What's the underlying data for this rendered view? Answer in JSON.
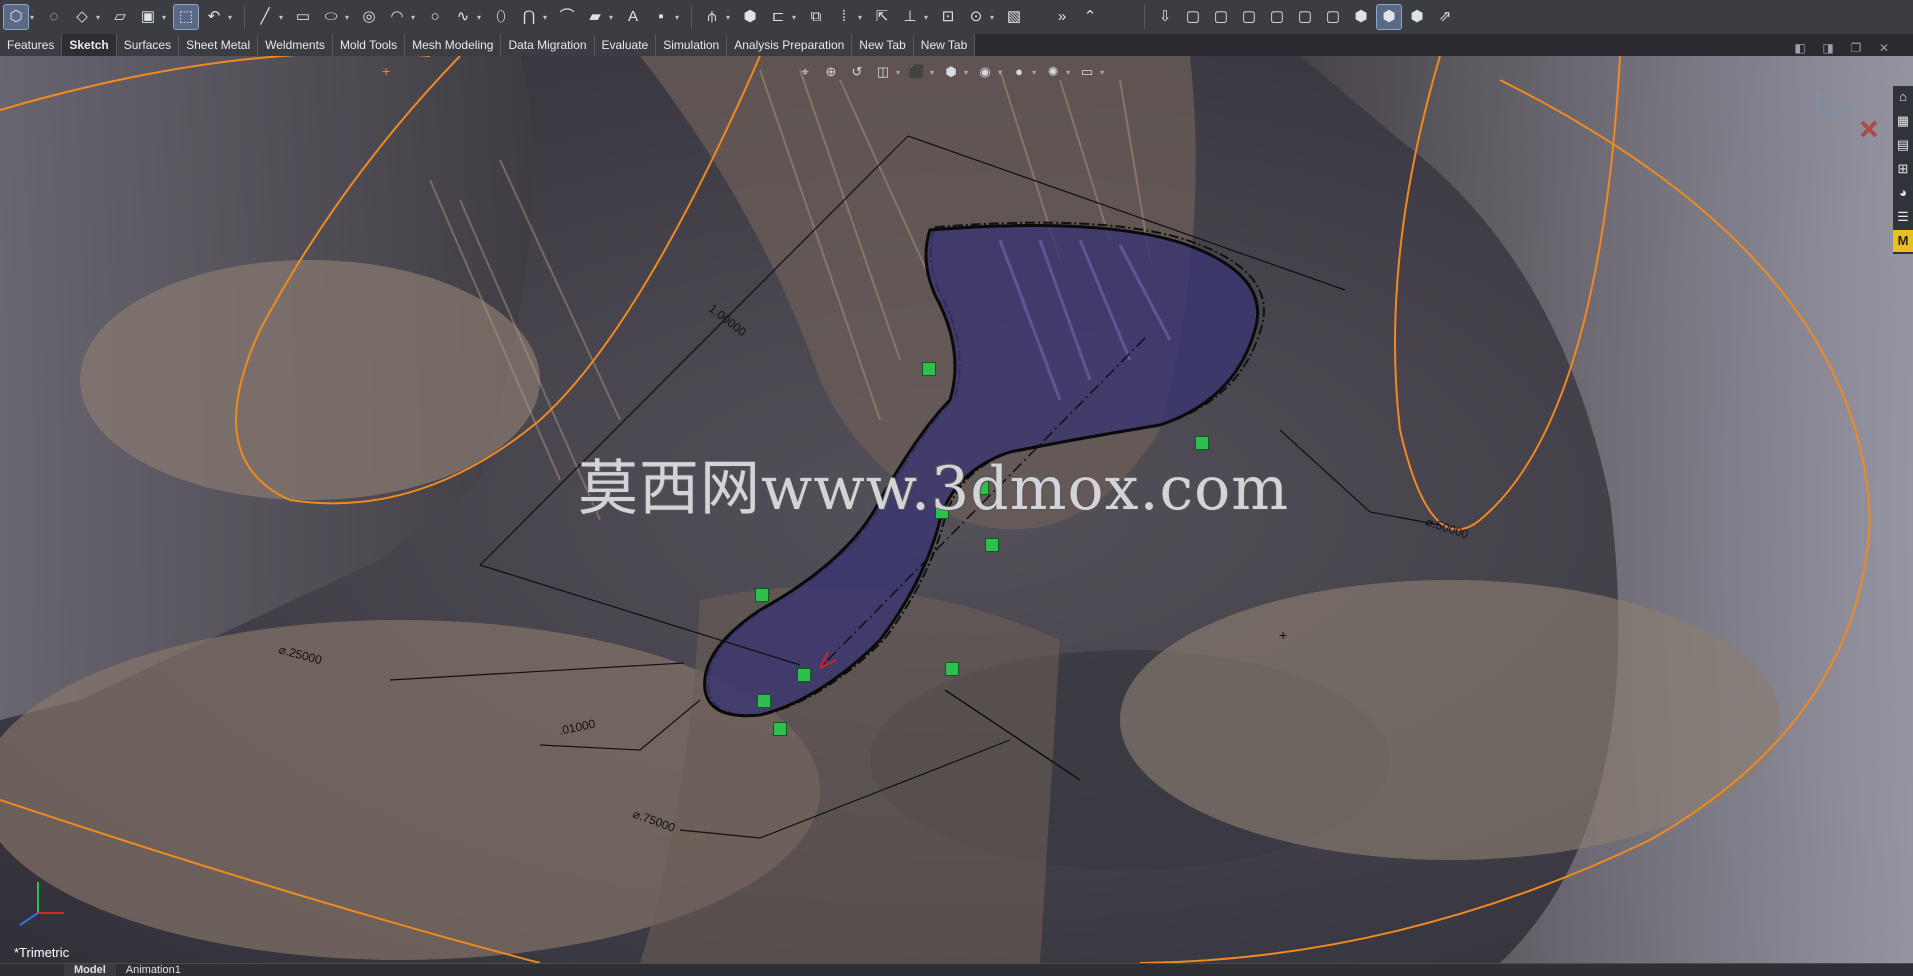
{
  "tabs": [
    {
      "label": "Features",
      "active": false
    },
    {
      "label": "Sketch",
      "active": true
    },
    {
      "label": "Surfaces",
      "active": false
    },
    {
      "label": "Sheet Metal",
      "active": false
    },
    {
      "label": "Weldments",
      "active": false
    },
    {
      "label": "Mold Tools",
      "active": false
    },
    {
      "label": "Mesh Modeling",
      "active": false
    },
    {
      "label": "Data Migration",
      "active": false
    },
    {
      "label": "Evaluate",
      "active": false
    },
    {
      "label": "Simulation",
      "active": false
    },
    {
      "label": "Analysis Preparation",
      "active": false
    },
    {
      "label": "New Tab",
      "active": false
    },
    {
      "label": "New Tab",
      "active": false
    }
  ],
  "toolbar": {
    "sketch_icons": [
      {
        "icon": "sketch-icon",
        "glyph": "⬡",
        "active": true
      },
      {
        "icon": "smart-dimension-icon",
        "glyph": "◌"
      },
      {
        "icon": "3d-sketch-icon",
        "glyph": "◇"
      },
      {
        "icon": "sketch-plane-icon",
        "glyph": "▱"
      },
      {
        "icon": "save-sketch-icon",
        "glyph": "▣"
      },
      {
        "icon": "exit-sketch-icon",
        "glyph": "⬚",
        "active": true
      },
      {
        "icon": "rapid-sketch-icon",
        "glyph": "↶"
      }
    ],
    "draw_icons": [
      {
        "icon": "line-icon",
        "glyph": "╱"
      },
      {
        "icon": "rectangle-icon",
        "glyph": "▭"
      },
      {
        "icon": "slot-icon",
        "glyph": "⬭"
      },
      {
        "icon": "circle-icon",
        "glyph": "◎"
      },
      {
        "icon": "arc-icon",
        "glyph": "◠"
      },
      {
        "icon": "polygon-icon",
        "glyph": "○"
      },
      {
        "icon": "spline-icon",
        "glyph": "∿"
      },
      {
        "icon": "ellipse-icon",
        "glyph": "⬯"
      },
      {
        "icon": "conic-icon",
        "glyph": "⋂"
      },
      {
        "icon": "fillet-icon",
        "glyph": "⌒"
      },
      {
        "icon": "plane-icon",
        "glyph": "▰"
      },
      {
        "icon": "text-icon",
        "glyph": "A"
      },
      {
        "icon": "point-icon",
        "glyph": "▪"
      }
    ],
    "modify_icons": [
      {
        "icon": "trim-icon",
        "glyph": "⫛"
      },
      {
        "icon": "convert-icon",
        "glyph": "⬢"
      },
      {
        "icon": "offset-icon",
        "glyph": "⊏"
      },
      {
        "icon": "mirror-icon",
        "glyph": "⧉"
      },
      {
        "icon": "pattern-icon",
        "glyph": "⁞"
      },
      {
        "icon": "move-icon",
        "glyph": "⇱"
      },
      {
        "icon": "relations-icon",
        "glyph": "⊥"
      },
      {
        "icon": "repair-icon",
        "glyph": "⊡"
      },
      {
        "icon": "quick-snaps-icon",
        "glyph": "⊙"
      },
      {
        "icon": "instant2d-icon",
        "glyph": "▧"
      }
    ],
    "more_glyph": "»",
    "collapse_glyph": "⌃",
    "view_icons": [
      {
        "icon": "view-orientation-icon",
        "glyph": "⇩"
      },
      {
        "icon": "front-view-icon",
        "glyph": "▢"
      },
      {
        "icon": "back-view-icon",
        "glyph": "▢"
      },
      {
        "icon": "left-view-icon",
        "glyph": "▢"
      },
      {
        "icon": "right-view-icon",
        "glyph": "▢"
      },
      {
        "icon": "top-view-icon",
        "glyph": "▢"
      },
      {
        "icon": "bottom-view-icon",
        "glyph": "▢"
      },
      {
        "icon": "isometric-view-icon",
        "glyph": "⬢"
      },
      {
        "icon": "trimetric-view-icon",
        "glyph": "⬢",
        "active": true
      },
      {
        "icon": "dimetric-view-icon",
        "glyph": "⬢"
      },
      {
        "icon": "normal-to-icon",
        "glyph": "⇗"
      }
    ]
  },
  "hud": [
    {
      "icon": "zoom-to-fit-icon",
      "glyph": "⌖"
    },
    {
      "icon": "zoom-area-icon",
      "glyph": "⊕"
    },
    {
      "icon": "previous-view-icon",
      "glyph": "↺"
    },
    {
      "icon": "section-view-icon",
      "glyph": "◫"
    },
    {
      "icon": "view-orientation-hud-icon",
      "glyph": "⬛"
    },
    {
      "icon": "display-style-icon",
      "glyph": "⬢"
    },
    {
      "icon": "hide-show-icon",
      "glyph": "◉"
    },
    {
      "icon": "edit-appearance-icon",
      "glyph": "●"
    },
    {
      "icon": "scenes-icon",
      "glyph": "✺"
    },
    {
      "icon": "view-settings-icon",
      "glyph": "▭"
    }
  ],
  "window_controls": [
    {
      "icon": "tile-left-icon",
      "glyph": "◧"
    },
    {
      "icon": "tile-right-icon",
      "glyph": "◨"
    },
    {
      "icon": "restore-icon",
      "glyph": "❐"
    },
    {
      "icon": "close-icon",
      "glyph": "✕"
    }
  ],
  "task_pane": [
    {
      "icon": "home-icon",
      "glyph": "⌂"
    },
    {
      "icon": "design-library-icon",
      "glyph": "▦"
    },
    {
      "icon": "file-explorer-icon",
      "glyph": "▤"
    },
    {
      "icon": "view-palette-icon",
      "glyph": "⊞"
    },
    {
      "icon": "appearances-icon",
      "glyph": "◕"
    },
    {
      "icon": "custom-properties-icon",
      "glyph": "☰"
    },
    {
      "icon": "mold-icon",
      "glyph": "M"
    }
  ],
  "dimensions": {
    "d1": "1.00000",
    "d2": "⌀.50000",
    "d3": "⌀.25000",
    "d4": ".01000",
    "d5": "⌀.75000"
  },
  "view_label": "*Trimetric",
  "watermark": "莫西网www.3dmox.com",
  "bottom_tabs": [
    {
      "label": "Model",
      "active": true
    },
    {
      "label": "Animation1",
      "active": false
    }
  ],
  "colors": {
    "background": "#2a2a30",
    "surface": "#7b6a60",
    "sketch_fill": "#3a3470",
    "profile_curve": "#f08a20",
    "relation_marker": "#2fbf4f"
  }
}
